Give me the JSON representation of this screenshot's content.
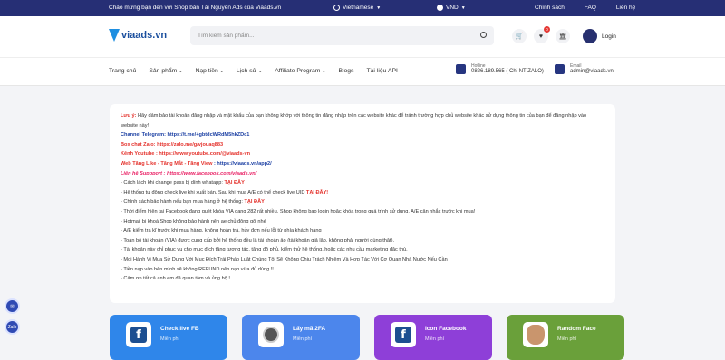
{
  "topbar": {
    "welcome": "Chào mừng bạn đến với Shop bán Tài Nguyên Ads của Viaads.vn",
    "language": "Vietnamese",
    "currency": "VND",
    "links": [
      "Chính sách",
      "FAQ",
      "Liên hệ"
    ]
  },
  "header": {
    "logo": "viaads.vn",
    "search_placeholder": "Tìm kiếm sản phẩm...",
    "notification_count": "0",
    "login": "Login"
  },
  "nav": {
    "items": [
      "Trang chủ",
      "Sản phẩm",
      "Nạp tiền",
      "Lịch sử",
      "Affiliate Program",
      "Blogs",
      "Tài liệu API"
    ],
    "hotline_label": "Hotline",
    "hotline_value": "0826.189.565 ( Chỉ NT ZALO)",
    "email_label": "Email",
    "email_value": "admin@viaads.vn"
  },
  "notice": {
    "warning_label": "Lưu ý:",
    "warning_text": " Hãy đảm bảo tài khoản đăng nhập và mật khẩu của bạn không khớp với thông tin đăng nhập trên các website khác để tránh trường hợp chủ website khác sử dụng thông tin của bạn để đăng nhập vào website này!",
    "telegram": "Channel Telegram: https://t.me/+gbtdcWRdM5hkZDc1",
    "zalo": "Box chat Zalo: https://zalo.me/g/vjouaq883",
    "youtube": "Kênh Youtube : https://www.youtube.com/@viaads-vn",
    "like_label": "Web Tăng Like - Tăng Mắt - Tăng View",
    "like_url": " : https://viaads.vn/app2/",
    "support": "Liên hệ Suppport : https://www.facebook.com/viaads.vn/",
    "lines": [
      {
        "text": "- Cách lách khi change pass bị dính whatapp: ",
        "tag": "TẠI ĐÂY"
      },
      {
        "text": "- Hệ thống tự động check live khi xuất bán. Sau khi mua A/E có thể check live UID ",
        "tag": "TẠI ĐÂY!"
      },
      {
        "text": "- Chính sách bảo hành nếu bạn mua hàng ở hệ thống: ",
        "tag": "TẠI ĐÂY"
      },
      {
        "text": "- Thời điểm hiện tại Facebook đang quét khóa VIA dạng 282 rất nhiều, Shop không bao login hoặc khóa trong  quá trình sử dụng, A/E cân nhắc trước khi mua!",
        "tag": ""
      },
      {
        "text": "- Hotmail bị khoá Shop không bảo hành nên ae chủ động gỡ nhé",
        "tag": ""
      },
      {
        "text": "- A/E kiểm tra kĩ trước khi mua hàng, không hoàn trả, hủy đơn nếu lỗi từ phía khách hàng",
        "tag": ""
      },
      {
        "text": "- Toàn bộ tài khoản (VIA) được cung cấp bởi hệ thống đều là tài khoản ảo (tài khoản giả lập, không phải người dùng thật).",
        "tag": ""
      },
      {
        "text": "- Tài khoản này chỉ phục vụ cho mục đích tăng tương tác, tăng độ phủ, kiểm thử hệ thống, hoặc các nhu cầu marketing đặc thù.",
        "tag": ""
      },
      {
        "text": "- Mọi Hành Vi Mua Sử Dụng Với Mục Đích Trái Pháp Luật Chúng Tôi Sẽ Không Chịu Trách Nhiệm Và Hợp Tác Với Cơ Quan Nhà  Nước Nếu Cần",
        "tag": ""
      },
      {
        "text": "- Tiền nạp vào bên mình sẽ không REFUND nên nạp vừa đủ dùng !!",
        "tag": ""
      },
      {
        "text": "- Cảm ơn tất cả anh em đã quan tâm và ủng hộ !",
        "tag": ""
      }
    ]
  },
  "cards": [
    {
      "title": "Check live FB",
      "sub": "Miễn phí",
      "color": "#2f86ea",
      "icon": "facebook-icon"
    },
    {
      "title": "Lấy mã 2FA",
      "sub": "Miễn phí",
      "color": "#4c86ec",
      "icon": "toggle-icon"
    },
    {
      "title": "Icon Facebook",
      "sub": "Miễn phí",
      "color": "#8e3fd8",
      "icon": "facebook-icon"
    },
    {
      "title": "Random Face",
      "sub": "Miễn phí",
      "color": "#6aa03a",
      "icon": "face-icon"
    }
  ],
  "floating": [
    "Messenger",
    "Zalo"
  ]
}
